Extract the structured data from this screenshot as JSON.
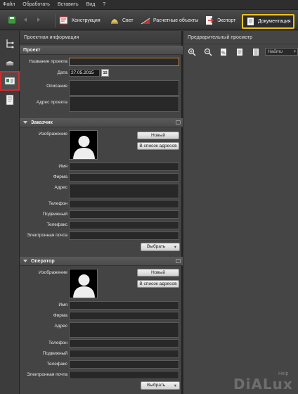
{
  "menu": [
    "Файл",
    "Обработать",
    "Вставить",
    "Вид",
    "?"
  ],
  "toolbar": {
    "tabs": [
      {
        "label": "Конструкция",
        "icon": "construction-icon"
      },
      {
        "label": "Свет",
        "icon": "light-icon"
      },
      {
        "label": "Расчетные объекты",
        "icon": "calc-objects-icon"
      },
      {
        "label": "Экспорт",
        "icon": "export-icon"
      }
    ],
    "active_tab": {
      "label": "Документация",
      "icon": "documentation-icon"
    },
    "highlight_color": "#f0c419"
  },
  "left_panel": {
    "title": "Проектная информация",
    "project": {
      "header": "Проект",
      "name_label": "Название проекта",
      "name_value": "",
      "date_label": "Дата",
      "date_value": "27.05.2015",
      "calendar_label": "15",
      "description_label": "Описание",
      "address_label": "Адрес проекта"
    },
    "customer": {
      "header": "Заказчик",
      "image_label": "Изображение",
      "new_button": "Новый",
      "address_list_button": "В список адресов",
      "name_label": "Имя",
      "company_label": "Фирма",
      "address_label": "Адрес",
      "phone_label": "Телефон",
      "mobile_label": "Подвижный",
      "fax_label": "Телефакс",
      "email_label": "Электронная почта",
      "select_button": "Выбрать"
    },
    "operator": {
      "header": "Оператор",
      "image_label": "Изображение",
      "new_button": "Новый",
      "address_list_button": "В список адресов",
      "name_label": "Имя",
      "company_label": "Фирма",
      "address_label": "Адрес",
      "phone_label": "Телефон",
      "mobile_label": "Подвижный",
      "fax_label": "Телефакс",
      "email_label": "Электронная почта",
      "select_button": "Выбрать"
    }
  },
  "right_panel": {
    "title": "Предварительный просмотр",
    "search_placeholder": "Найти"
  },
  "watermark": {
    "text": "DiALux",
    "help": "Help"
  },
  "highlight_red": "#d42a2a"
}
